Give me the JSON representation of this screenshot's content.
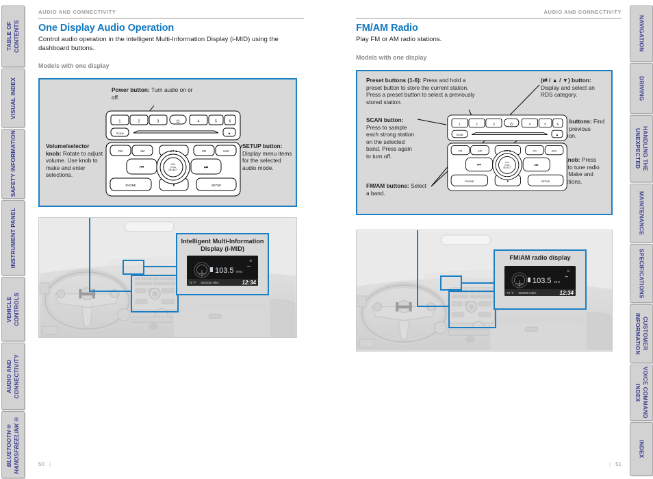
{
  "tabs_left": [
    {
      "label": "TABLE OF CONTENTS",
      "italic": false
    },
    {
      "label": "VISUAL INDEX",
      "italic": false
    },
    {
      "label": "SAFETY INFORMATION",
      "italic": false
    },
    {
      "label": "INSTRUMENT PANEL",
      "italic": false
    },
    {
      "label": "VEHICLE\nCONTROLS",
      "italic": false
    },
    {
      "label": "AUDIO AND\nCONNECTIVITY",
      "italic": false
    },
    {
      "label": "BLUETOOTH®\nHANDSFREELINK®",
      "italic": true
    }
  ],
  "tabs_right": [
    {
      "label": "NAVIGATION"
    },
    {
      "label": "DRIVING"
    },
    {
      "label": "HANDLING THE\nUNEXPECTED"
    },
    {
      "label": "MAINTENANCE"
    },
    {
      "label": "SPECIFICATIONS"
    },
    {
      "label": "CUSTOMER\nINFORMATION"
    },
    {
      "label": "VOICE COMMAND\nINDEX"
    },
    {
      "label": "INDEX"
    }
  ],
  "left_page": {
    "running_head": "AUDIO AND CONNECTIVITY",
    "title": "One Display Audio Operation",
    "intro": "Control audio operation in the intelligent Multi-Information Display (i-MID) using the dashboard buttons.",
    "sub_note": "Models with one display",
    "folio": "50",
    "callouts": [
      {
        "name": "power-button",
        "label": "Power button:",
        "text": " Turn audio on or off."
      },
      {
        "name": "volume-selector-knob",
        "label": "Volume/selector knob:",
        "text": " Rotate to adjust volume. Use knob to make and enter selections."
      },
      {
        "name": "setup-button",
        "label": "SETUP button:",
        "text": " Display menu items for the selected audio mode."
      }
    ],
    "photo_callout": {
      "title_line1": "Intelligent Multi-Information",
      "title_line2": "Display (i-MID)"
    }
  },
  "right_page": {
    "running_head": "AUDIO AND CONNECTIVITY",
    "title": "FM/AM Radio",
    "intro": "Play FM or AM radio stations.",
    "sub_note": "Models with one display",
    "folio": "51",
    "callouts": [
      {
        "name": "preset-buttons",
        "label": "Preset buttons (1-6):",
        "text": " Press and hold a preset button to store the current station. Press a preset button to select a previously stored station."
      },
      {
        "name": "scan-button",
        "label": "SCAN button:",
        "text": " Press to sample each strong station on the selected band. Press again to turn off."
      },
      {
        "name": "fm-am-buttons",
        "label": "FM/AM buttons:",
        "text": " Select a band."
      },
      {
        "name": "rds-button",
        "label": "(⇄ / ▲ / ▼) button:",
        "text": " Display and select an RDS category."
      },
      {
        "name": "seek-skip-buttons",
        "label": "Seek/Skip buttons:",
        "text": " Find the next or previous strong station."
      },
      {
        "name": "selector-knob",
        "label": "Selector knob:",
        "text": " Press and rotate to tune radio frequency. Make and enter selections."
      }
    ],
    "photo_callout": {
      "title_line1": "FM/AM radio display",
      "title_line2": ""
    }
  },
  "radio_panel": {
    "presets": [
      "1",
      "2",
      "3",
      "4",
      "5",
      "6"
    ],
    "power_glyph": "⏻",
    "scan_label": "SCAN",
    "eject_glyph": "⏏",
    "source_buttons": [
      "FM",
      "AM",
      "⇄ / ▲",
      "CD",
      "AUX"
    ],
    "prev_glyph": "⏮",
    "next_glyph": "⏭",
    "knob_line1": "VOL",
    "knob_line2": "PUSH",
    "knob_line3": "SELECT",
    "phone_label": "PHONE",
    "down_glyph": "▼",
    "setup_label": "SETUP"
  },
  "mid_display": {
    "band": "FM",
    "preset_number": "1",
    "frequency": "103.5",
    "unit": "MHz",
    "temperature": "75 °F",
    "odometer": "002300",
    "odometer_unit": "miles",
    "clock": "12:34"
  },
  "colors": {
    "accent_blue": "#1279bf",
    "box_border_blue": "#1a7ec4",
    "tab_text": "#3b3b8f",
    "tab_bg": "#d2d2d2",
    "box_fill": "#d9d9d9",
    "body_text": "#231f20",
    "muted": "#9a9a9a"
  }
}
